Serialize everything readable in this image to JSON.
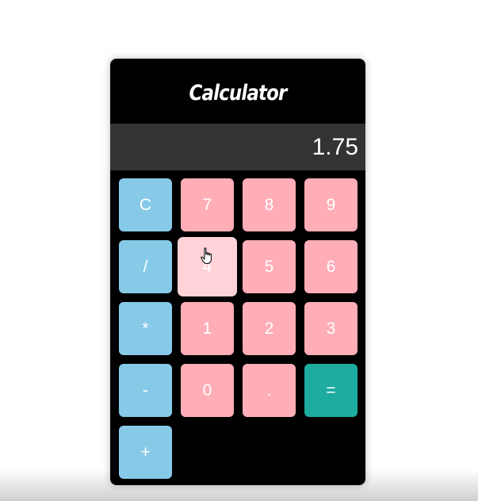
{
  "app": {
    "title": "Calculator"
  },
  "display": {
    "value": "1.75"
  },
  "keys": {
    "clear": "C",
    "divide": "/",
    "multiply": "*",
    "subtract": "-",
    "add": "+",
    "seven": "7",
    "eight": "8",
    "nine": "9",
    "four": "4",
    "five": "5",
    "six": "6",
    "one": "1",
    "two": "2",
    "three": "3",
    "zero": "0",
    "decimal": ".",
    "equals": "="
  },
  "colors": {
    "background": "#000000",
    "display": "#333333",
    "operator_key": "#87cae8",
    "number_key": "#ffadb7",
    "number_key_hover": "#ffd3d7",
    "equals_key": "#1eaca0",
    "text": "#ffffff"
  },
  "icons": {
    "cursor": "hand-pointer-icon"
  }
}
